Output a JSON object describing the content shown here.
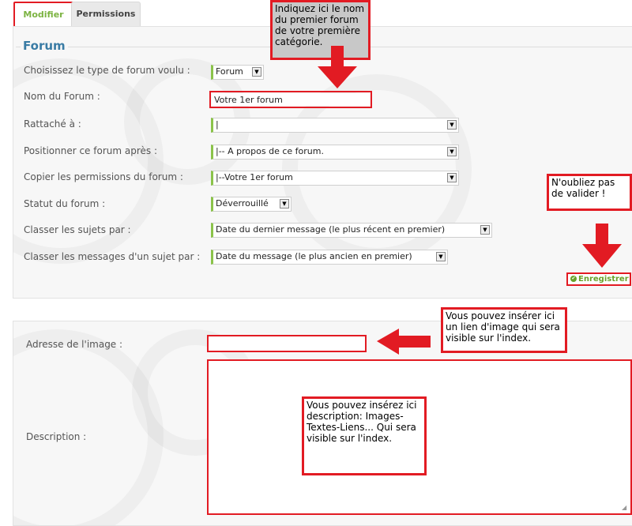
{
  "tabs": {
    "active": "Modifier",
    "other": "Permissions"
  },
  "section1": {
    "legend": "Forum",
    "fields": {
      "type": {
        "label": "Choisissez le type de forum voulu :",
        "value": "Forum"
      },
      "name": {
        "label": "Nom du Forum :",
        "value": "Votre 1er forum"
      },
      "attached": {
        "label": "Rattaché à :",
        "value": "|"
      },
      "position": {
        "label": "Positionner ce forum après :",
        "value": "|-- A propos de ce forum."
      },
      "copy_perms": {
        "label": "Copier les permissions du forum :",
        "value": "|--Votre 1er forum"
      },
      "status": {
        "label": "Statut du forum :",
        "value": "Déverrouillé"
      },
      "sort_topics": {
        "label": "Classer les sujets par :",
        "value": "Date du dernier message (le plus récent en premier)"
      },
      "sort_posts": {
        "label": "Classer les messages d'un sujet par :",
        "value": "Date du message (le plus ancien en premier)"
      }
    },
    "save_label": "Enregistrer"
  },
  "section2": {
    "image_label": "Adresse de l'image :",
    "image_value": "",
    "description_label": "Description :"
  },
  "annotations": {
    "name_hint": "Indiquez ici le nom du premier forum de votre première catégorie.",
    "validate_hint": "N'oubliez pas de valider !",
    "image_hint": "Vous pouvez insérer ici un lien d'image qui sera visible sur l'index.",
    "description_hint": "Vous pouvez insérez ici description: Images-Textes-Liens... Qui sera visible sur l'index."
  },
  "colors": {
    "annotation_red": "#e21b23",
    "active_tab_green": "#7cb342",
    "legend_blue": "#3a7ca5",
    "field_accent": "#8bc34a"
  }
}
